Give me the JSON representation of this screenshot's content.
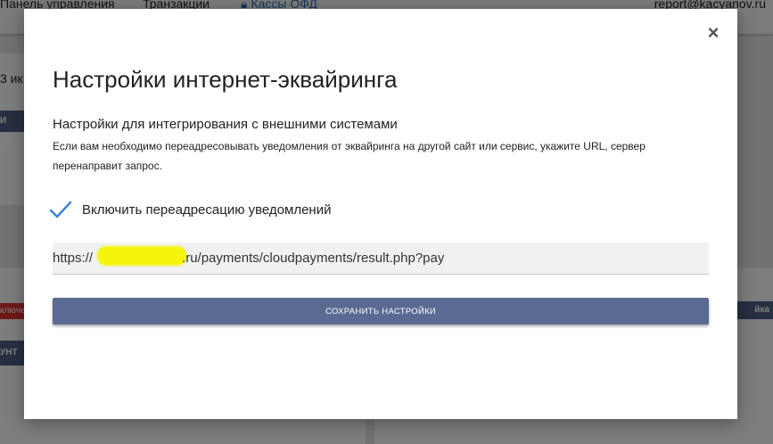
{
  "background": {
    "nav_item_1": "Панель управления",
    "nav_item_2": "Транзакции",
    "nav_link": "Кассы ОФД",
    "user_email": "report@kacyanov.ru",
    "left_text": "3 ик",
    "left_button_1": "И ДАН",
    "left_badge": "ключе",
    "left_button_2": "УНТ",
    "right_badge": "йка"
  },
  "modal": {
    "close_glyph": "×",
    "title": "Настройки интернет-эквайринга",
    "subtitle": "Настройки для интегрирования с внешними системами",
    "description": "Если вам необходимо переадресовывать уведомления от эквайринга на другой сайт или сервис, укажите URL, сервер перенаправит запрос.",
    "checkbox": {
      "label": "Включить переадресацию уведомлений",
      "checked": true,
      "check_color": "#3b82d6"
    },
    "url_field": {
      "prefix": "https://",
      "value_suffix": ".ru/payments/cloudpayments/result.php?pay",
      "redaction_color": "#f6f40a"
    },
    "save_button": "СОХРАНИТЬ НАСТРОЙКИ",
    "accent_color": "#5a6a92"
  }
}
